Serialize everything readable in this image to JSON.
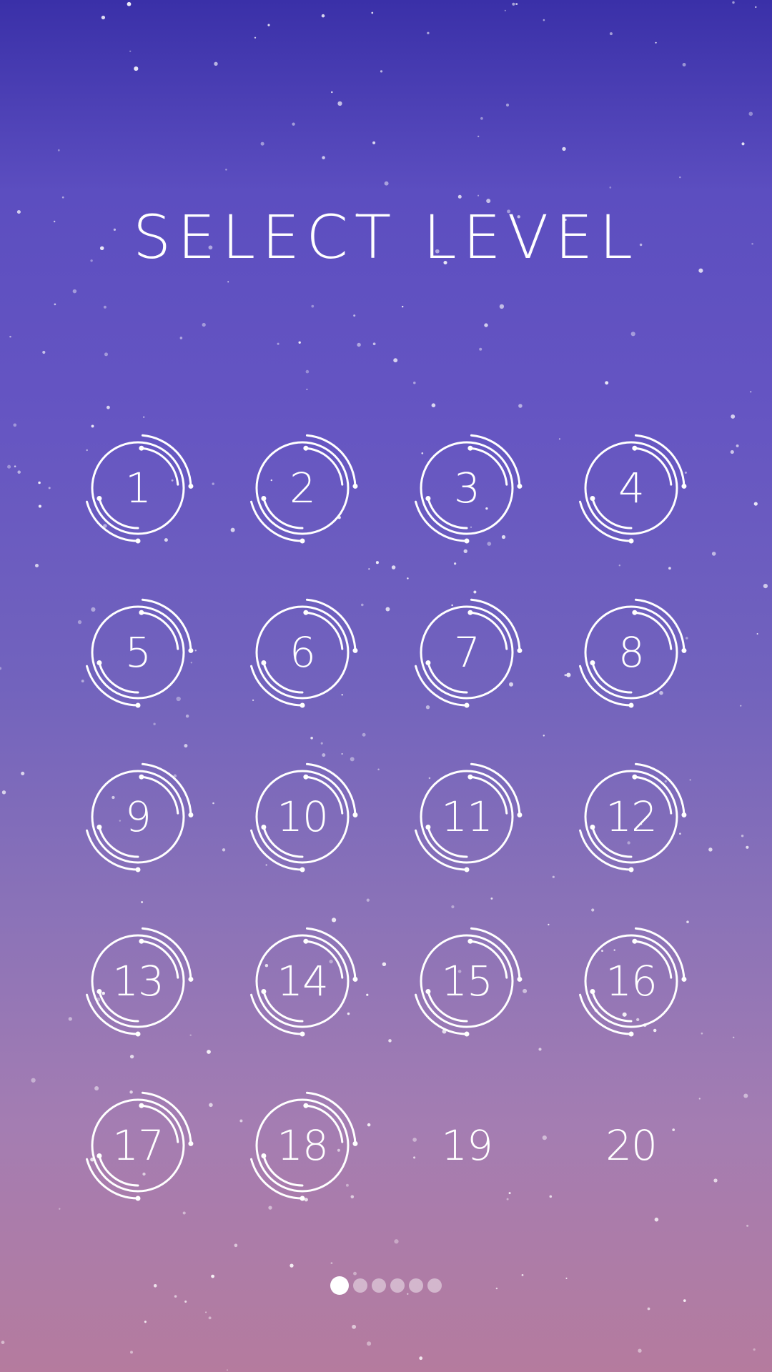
{
  "screen": {
    "title": "SELECT LEVEL"
  },
  "levels": [
    {
      "label": "1",
      "unlocked": true
    },
    {
      "label": "2",
      "unlocked": true
    },
    {
      "label": "3",
      "unlocked": true
    },
    {
      "label": "4",
      "unlocked": true
    },
    {
      "label": "5",
      "unlocked": true
    },
    {
      "label": "6",
      "unlocked": true
    },
    {
      "label": "7",
      "unlocked": true
    },
    {
      "label": "8",
      "unlocked": true
    },
    {
      "label": "9",
      "unlocked": true
    },
    {
      "label": "10",
      "unlocked": true
    },
    {
      "label": "11",
      "unlocked": true
    },
    {
      "label": "12",
      "unlocked": true
    },
    {
      "label": "13",
      "unlocked": true
    },
    {
      "label": "14",
      "unlocked": true
    },
    {
      "label": "15",
      "unlocked": true
    },
    {
      "label": "16",
      "unlocked": true
    },
    {
      "label": "17",
      "unlocked": true
    },
    {
      "label": "18",
      "unlocked": true
    },
    {
      "label": "19",
      "unlocked": false
    },
    {
      "label": "20",
      "unlocked": false
    }
  ],
  "pagination": {
    "pages": 6,
    "current": 1
  },
  "colors": {
    "ring": "#ffffff",
    "text": "#ffffff"
  }
}
